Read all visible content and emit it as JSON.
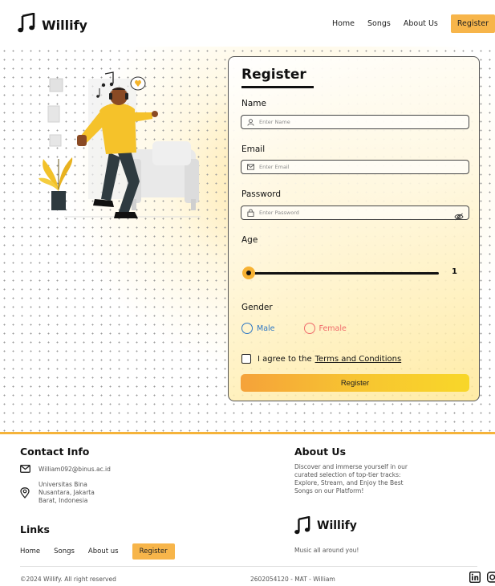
{
  "header": {
    "logo_text": "Willify",
    "nav": [
      {
        "label": "Home"
      },
      {
        "label": "Songs"
      },
      {
        "label": "About Us"
      },
      {
        "label": "Register"
      }
    ]
  },
  "form": {
    "title": "Register",
    "name": {
      "label": "Name",
      "placeholder": "Enter Name",
      "value": ""
    },
    "email": {
      "label": "Email",
      "placeholder": "Enter Email",
      "value": ""
    },
    "password": {
      "label": "Password",
      "placeholder": "Enter Password",
      "value": ""
    },
    "age": {
      "label": "Age",
      "value": "1"
    },
    "gender": {
      "label": "Gender",
      "options": [
        "Male",
        "Female"
      ]
    },
    "agree_text": "I agree to the",
    "terms_link": "Terms and Conditions",
    "submit_label": "Register"
  },
  "footer": {
    "contact_title": "Contact Info",
    "email": "William092@binus.ac.id",
    "address_line1": "Universitas Bina",
    "address_line2": "Nusantara, Jakarta",
    "address_line3": "Barat, Indonesia",
    "links_title": "Links",
    "links": [
      {
        "label": "Home"
      },
      {
        "label": "Songs"
      },
      {
        "label": "About us"
      },
      {
        "label": "Register"
      }
    ],
    "about_title": "About Us",
    "about_line1": "Discover and immerse yourself in our",
    "about_line2": "curated selection of top-tier tracks:",
    "about_line3": "Explore, Stream, and Enjoy the Best",
    "about_line4": "Songs on our Platform!",
    "brand": "Willify",
    "tagline": "Music all around you!",
    "copyright": "©2024 Willify. All right reserved",
    "student_id": "2602054120 - MAT - William"
  },
  "colors": {
    "accent": "#f7b54a",
    "male": "#2f78c4",
    "female": "#f06a6a"
  },
  "icons": [
    "music-note-icon",
    "user-icon",
    "mail-icon",
    "lock-icon",
    "eye-off-icon",
    "location-pin-icon",
    "linkedin-icon",
    "instagram-icon"
  ]
}
